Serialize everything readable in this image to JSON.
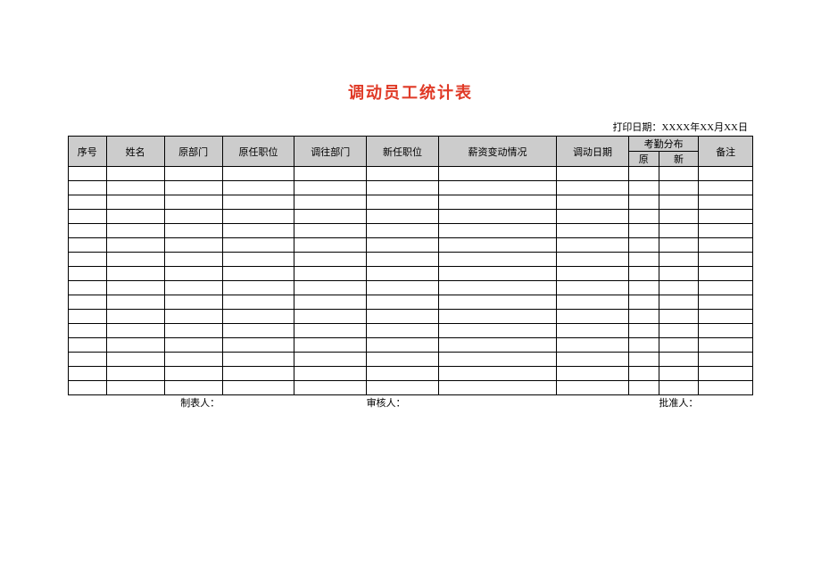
{
  "title": "调动员工统计表",
  "print_date_label": "打印日期：XXXX年XX月XX日",
  "headers": {
    "seq": "序号",
    "name": "姓名",
    "orig_dept": "原部门",
    "orig_pos": "原任职位",
    "new_dept": "调往部门",
    "new_pos": "新任职位",
    "salary_change": "薪资变动情况",
    "transfer_date": "调动日期",
    "attendance_group": "考勤分布",
    "attendance_orig": "原",
    "attendance_new": "新",
    "remark": "备注"
  },
  "footer": {
    "preparer": "制表人：",
    "reviewer": "审核人：",
    "approver": "批准人："
  },
  "rows": [
    {
      "seq": "",
      "name": "",
      "orig_dept": "",
      "orig_pos": "",
      "new_dept": "",
      "new_pos": "",
      "salary_change": "",
      "transfer_date": "",
      "att_orig": "",
      "att_new": "",
      "remark": ""
    },
    {
      "seq": "",
      "name": "",
      "orig_dept": "",
      "orig_pos": "",
      "new_dept": "",
      "new_pos": "",
      "salary_change": "",
      "transfer_date": "",
      "att_orig": "",
      "att_new": "",
      "remark": ""
    },
    {
      "seq": "",
      "name": "",
      "orig_dept": "",
      "orig_pos": "",
      "new_dept": "",
      "new_pos": "",
      "salary_change": "",
      "transfer_date": "",
      "att_orig": "",
      "att_new": "",
      "remark": ""
    },
    {
      "seq": "",
      "name": "",
      "orig_dept": "",
      "orig_pos": "",
      "new_dept": "",
      "new_pos": "",
      "salary_change": "",
      "transfer_date": "",
      "att_orig": "",
      "att_new": "",
      "remark": ""
    },
    {
      "seq": "",
      "name": "",
      "orig_dept": "",
      "orig_pos": "",
      "new_dept": "",
      "new_pos": "",
      "salary_change": "",
      "transfer_date": "",
      "att_orig": "",
      "att_new": "",
      "remark": ""
    },
    {
      "seq": "",
      "name": "",
      "orig_dept": "",
      "orig_pos": "",
      "new_dept": "",
      "new_pos": "",
      "salary_change": "",
      "transfer_date": "",
      "att_orig": "",
      "att_new": "",
      "remark": ""
    },
    {
      "seq": "",
      "name": "",
      "orig_dept": "",
      "orig_pos": "",
      "new_dept": "",
      "new_pos": "",
      "salary_change": "",
      "transfer_date": "",
      "att_orig": "",
      "att_new": "",
      "remark": ""
    },
    {
      "seq": "",
      "name": "",
      "orig_dept": "",
      "orig_pos": "",
      "new_dept": "",
      "new_pos": "",
      "salary_change": "",
      "transfer_date": "",
      "att_orig": "",
      "att_new": "",
      "remark": ""
    },
    {
      "seq": "",
      "name": "",
      "orig_dept": "",
      "orig_pos": "",
      "new_dept": "",
      "new_pos": "",
      "salary_change": "",
      "transfer_date": "",
      "att_orig": "",
      "att_new": "",
      "remark": ""
    },
    {
      "seq": "",
      "name": "",
      "orig_dept": "",
      "orig_pos": "",
      "new_dept": "",
      "new_pos": "",
      "salary_change": "",
      "transfer_date": "",
      "att_orig": "",
      "att_new": "",
      "remark": ""
    },
    {
      "seq": "",
      "name": "",
      "orig_dept": "",
      "orig_pos": "",
      "new_dept": "",
      "new_pos": "",
      "salary_change": "",
      "transfer_date": "",
      "att_orig": "",
      "att_new": "",
      "remark": ""
    },
    {
      "seq": "",
      "name": "",
      "orig_dept": "",
      "orig_pos": "",
      "new_dept": "",
      "new_pos": "",
      "salary_change": "",
      "transfer_date": "",
      "att_orig": "",
      "att_new": "",
      "remark": ""
    },
    {
      "seq": "",
      "name": "",
      "orig_dept": "",
      "orig_pos": "",
      "new_dept": "",
      "new_pos": "",
      "salary_change": "",
      "transfer_date": "",
      "att_orig": "",
      "att_new": "",
      "remark": ""
    },
    {
      "seq": "",
      "name": "",
      "orig_dept": "",
      "orig_pos": "",
      "new_dept": "",
      "new_pos": "",
      "salary_change": "",
      "transfer_date": "",
      "att_orig": "",
      "att_new": "",
      "remark": ""
    },
    {
      "seq": "",
      "name": "",
      "orig_dept": "",
      "orig_pos": "",
      "new_dept": "",
      "new_pos": "",
      "salary_change": "",
      "transfer_date": "",
      "att_orig": "",
      "att_new": "",
      "remark": ""
    },
    {
      "seq": "",
      "name": "",
      "orig_dept": "",
      "orig_pos": "",
      "new_dept": "",
      "new_pos": "",
      "salary_change": "",
      "transfer_date": "",
      "att_orig": "",
      "att_new": "",
      "remark": ""
    }
  ]
}
